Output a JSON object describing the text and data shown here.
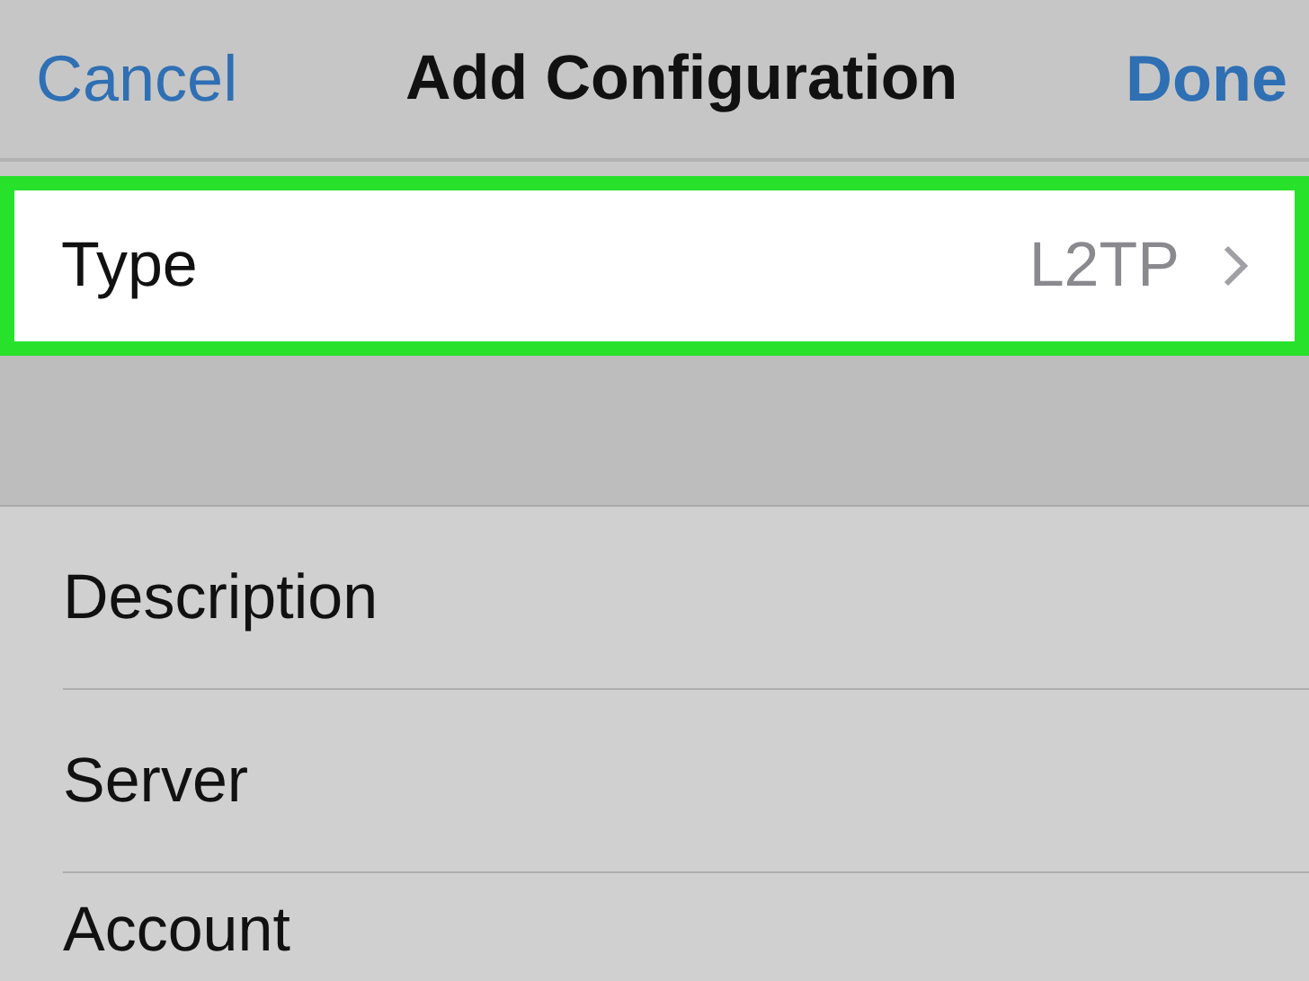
{
  "nav": {
    "cancel": "Cancel",
    "title": "Add Configuration",
    "done": "Done"
  },
  "type_row": {
    "label": "Type",
    "value": "L2TP",
    "highlighted": true
  },
  "fields": [
    {
      "label": "Description"
    },
    {
      "label": "Server"
    },
    {
      "label": "Account"
    }
  ]
}
